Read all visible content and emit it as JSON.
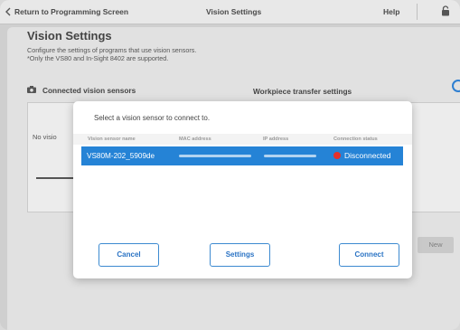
{
  "topbar": {
    "back_label": "Return to Programming Screen",
    "title": "Vision Settings",
    "help": "Help"
  },
  "page": {
    "title": "Vision Settings",
    "desc_line1": "Configure the settings of programs that use vision sensors.",
    "desc_line2": "*Only the VS80 and In-Sight 8402 are supported.",
    "section_left": "Connected vision sensors",
    "section_right": "Workpiece transfer settings",
    "bg_left_text": "No visio",
    "bg_new_button": "New"
  },
  "modal": {
    "prompt": "Select a vision sensor to connect to.",
    "columns": [
      "Vision sensor name",
      "MAC address",
      "IP address",
      "Connection status"
    ],
    "rows": [
      {
        "name": "VS80M-202_5909de",
        "status": "Disconnected",
        "status_color": "#e6302b"
      }
    ],
    "buttons": {
      "cancel": "Cancel",
      "settings": "Settings",
      "connect": "Connect"
    }
  },
  "colors": {
    "accent": "#2583d6",
    "button_text": "#2a73c4"
  },
  "icons": {
    "back": "chevron-left-icon",
    "lock": "lock-icon",
    "camera": "camera-icon",
    "circle": "circle-icon"
  }
}
